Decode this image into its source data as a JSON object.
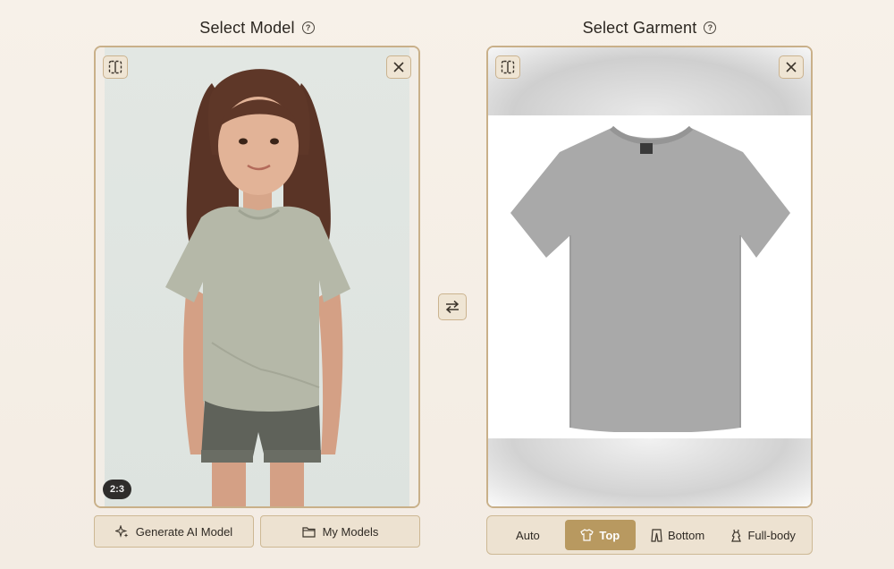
{
  "model_section": {
    "title": "Select Model",
    "ratio_badge": "2:3",
    "actions": {
      "generate_label": "Generate AI Model",
      "my_models_label": "My Models"
    }
  },
  "garment_section": {
    "title": "Select Garment",
    "categories": [
      {
        "label": "Auto",
        "selected": false
      },
      {
        "label": "Top",
        "selected": true
      },
      {
        "label": "Bottom",
        "selected": false
      },
      {
        "label": "Full-body",
        "selected": false
      }
    ]
  },
  "icons": {
    "help": "help-circle-icon",
    "split": "split-view-icon",
    "close": "close-icon",
    "swap": "swap-arrows-icon",
    "sparkle": "sparkle-icon",
    "folder": "folder-icon",
    "shirt": "tshirt-icon",
    "pants": "pants-icon",
    "dress": "full-body-icon"
  },
  "colors": {
    "accent": "#b89960",
    "panel_border": "#c9b089",
    "button_bg": "#ede2d1",
    "page_bg": "#f5eee5"
  }
}
